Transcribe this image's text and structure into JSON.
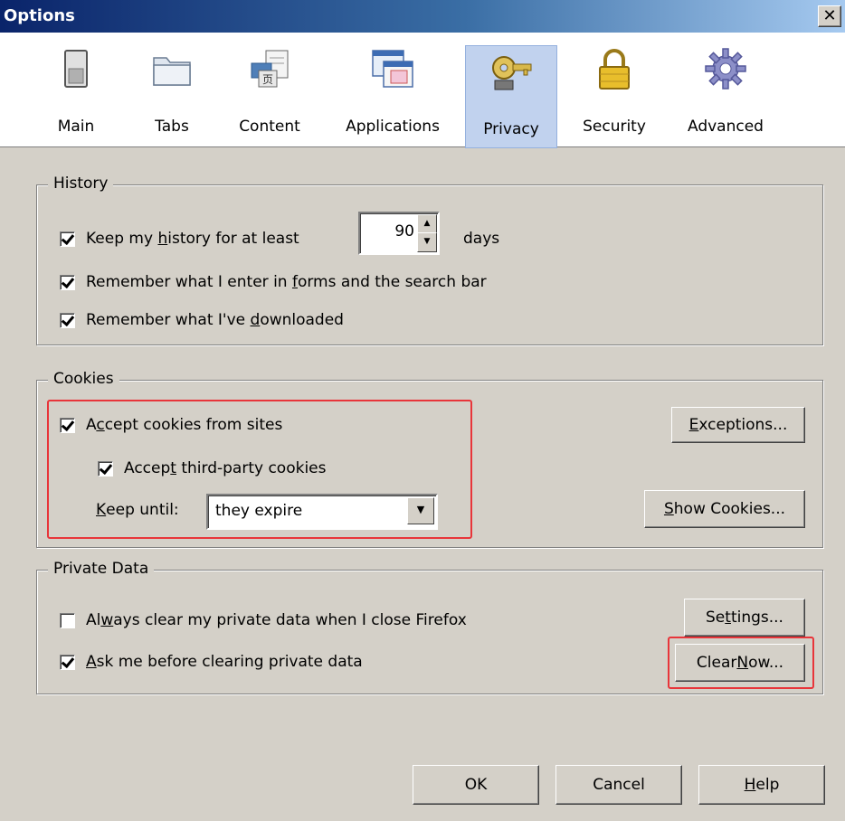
{
  "window": {
    "title": "Options",
    "close_glyph": "✕"
  },
  "toolbar": {
    "items": [
      {
        "label": "Main",
        "icon": "main-switch-icon"
      },
      {
        "label": "Tabs",
        "icon": "tabs-folder-icon"
      },
      {
        "label": "Content",
        "icon": "content-page-icon"
      },
      {
        "label": "Applications",
        "icon": "applications-window-icon"
      },
      {
        "label": "Privacy",
        "icon": "privacy-key-icon",
        "selected": true
      },
      {
        "label": "Security",
        "icon": "security-lock-icon"
      },
      {
        "label": "Advanced",
        "icon": "advanced-gear-icon"
      }
    ]
  },
  "history": {
    "label": "History",
    "keep_history": {
      "pre": "Keep my ",
      "acc": "h",
      "post": "istory for at least",
      "checked": true
    },
    "days_value": "90",
    "days_label": "days",
    "remember_forms": {
      "pre": "Remember what I enter in ",
      "acc": "f",
      "post": "orms and the search bar",
      "checked": true
    },
    "remember_downloads": {
      "pre": "Remember what I've ",
      "acc": "d",
      "post": "ownloaded",
      "checked": true
    }
  },
  "cookies": {
    "label": "Cookies",
    "accept": {
      "pre": "A",
      "acc": "c",
      "post": "cept cookies from sites",
      "checked": true
    },
    "third_party": {
      "pre": "Accep",
      "acc": "t",
      "post": " third-party cookies",
      "checked": true
    },
    "keep_until": {
      "pre": "",
      "acc": "K",
      "post": "eep until:"
    },
    "keep_until_value": "they expire",
    "exceptions_button": {
      "pre": "",
      "acc": "E",
      "post": "xceptions..."
    },
    "show_cookies_button": {
      "pre": "",
      "acc": "S",
      "post": "how Cookies..."
    }
  },
  "private_data": {
    "label": "Private Data",
    "always_clear": {
      "pre": "Al",
      "acc": "w",
      "post": "ays clear my private data when I close Firefox",
      "checked": false
    },
    "ask_before": {
      "pre": "",
      "acc": "A",
      "post": "sk me before clearing private data",
      "checked": true
    },
    "settings_button": {
      "pre": "Se",
      "acc": "t",
      "post": "tings..."
    },
    "clear_now_button": {
      "pre": "Clear ",
      "acc": "N",
      "post": "ow..."
    }
  },
  "footer": {
    "ok_label": "OK",
    "cancel_label": "Cancel",
    "help_button": {
      "pre": "",
      "acc": "H",
      "post": "elp"
    }
  },
  "colors": {
    "highlight_box": "#e8353a",
    "title_gradient_start": "#0a246a",
    "selected_tab_bg": "#c1d2ee"
  }
}
